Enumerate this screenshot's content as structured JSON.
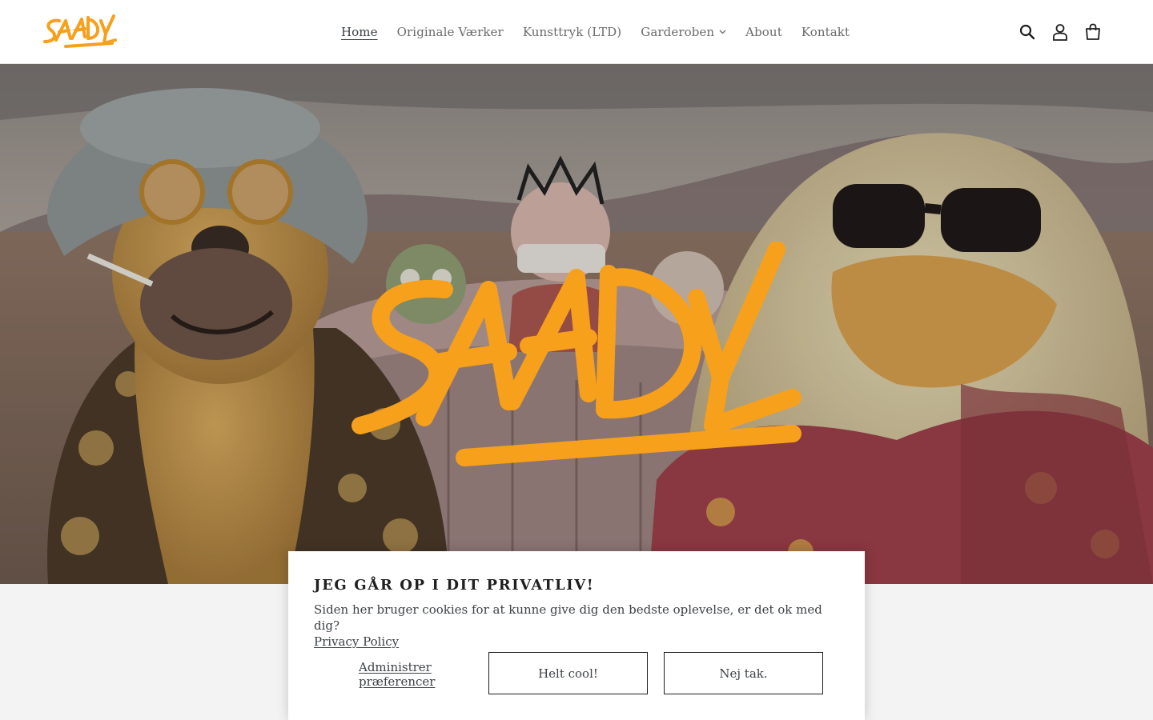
{
  "brand": {
    "name": "SAADY",
    "accent_color": "#f7a01c"
  },
  "nav": {
    "items": [
      {
        "label": "Home",
        "active": true
      },
      {
        "label": "Originale Værker"
      },
      {
        "label": "Kunsttryk (LTD)"
      },
      {
        "label": "Garderoben",
        "has_dropdown": true
      },
      {
        "label": "About"
      },
      {
        "label": "Kontakt"
      }
    ]
  },
  "header_icons": [
    "search-icon",
    "account-icon",
    "cart-icon"
  ],
  "hero": {
    "image_alt": "Painting of a cartoon dog in a bucket hat and a yellow bird in sunglasses driving a convertible through the desert with puppet passengers, overlaid with the SAADY logo"
  },
  "cookie": {
    "title": "JEG GÅR OP I DIT PRIVATLIV!",
    "text": "Siden her bruger cookies for at kunne give dig den bedste oplevelse, er det ok med dig?",
    "policy_link": "Privacy Policy",
    "prefs_label": "Administrer præferencer",
    "accept_label": "Helt cool!",
    "decline_label": "Nej tak."
  }
}
